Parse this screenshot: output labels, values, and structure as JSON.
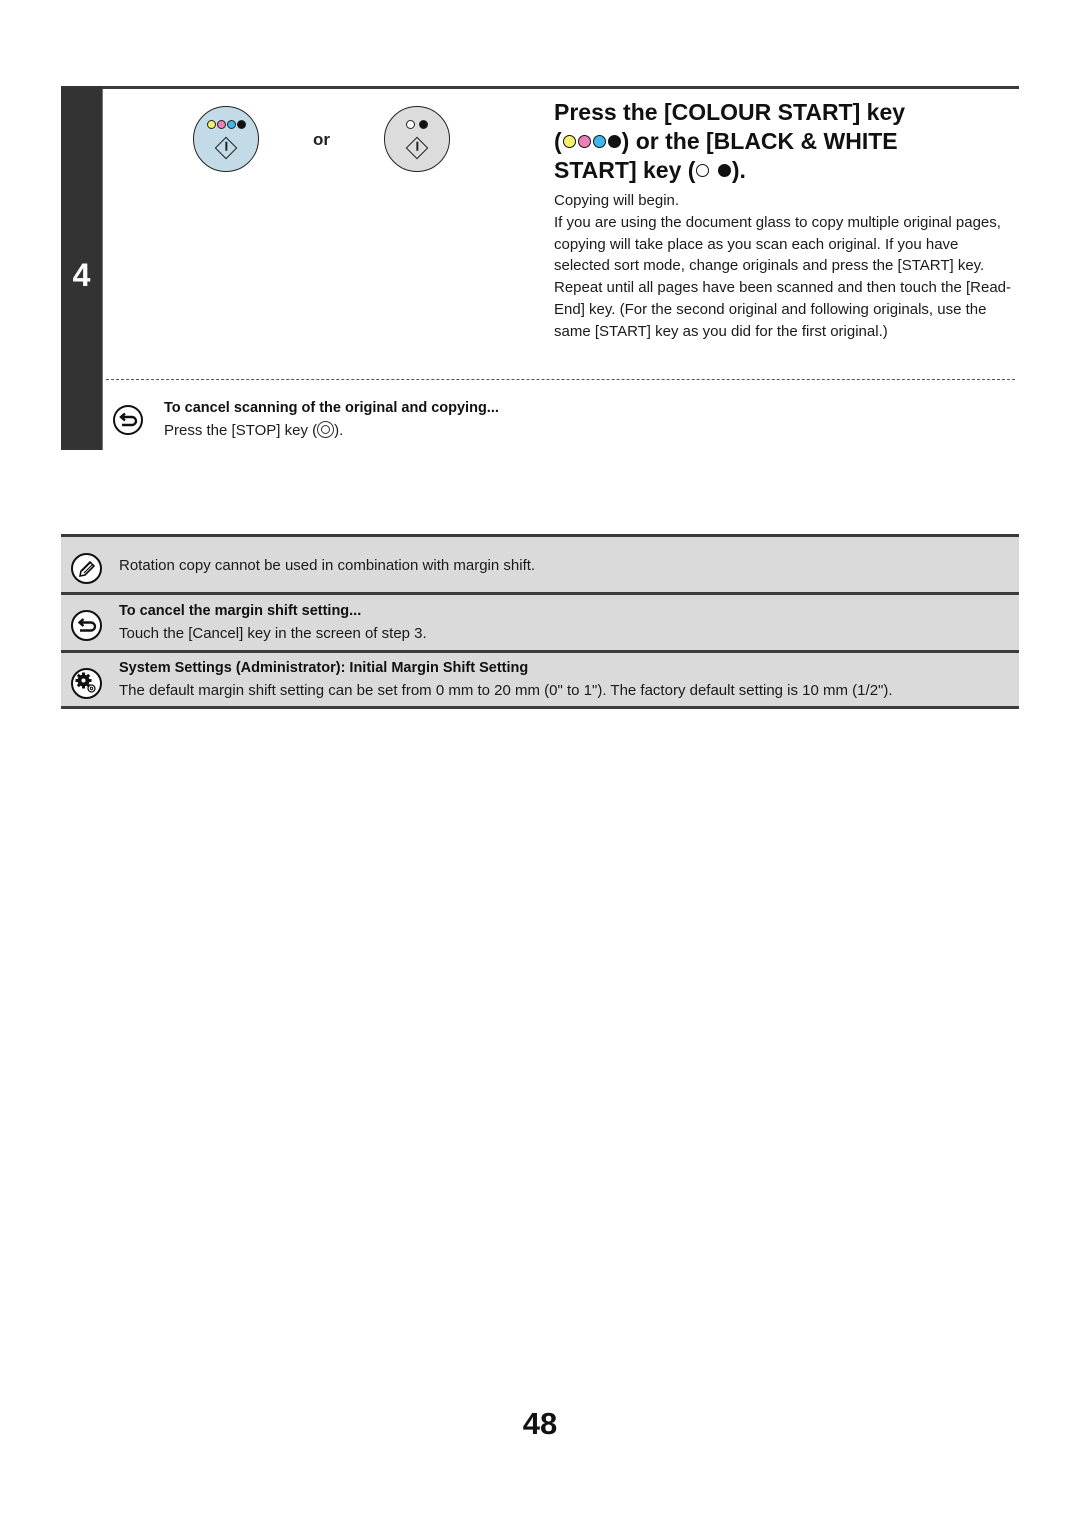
{
  "step": {
    "number": "4",
    "or_label": "or",
    "colour_key_dot_colors": [
      "#f4ee6e",
      "#ee7fb6",
      "#3db8ec",
      "#111111"
    ],
    "bw_key_dot_colors": [
      "#ffffff",
      "#111111"
    ],
    "title": {
      "line1": "Press the [COLOUR START] key",
      "line2_open": "(",
      "line2_rest": ") or the [BLACK & WHITE",
      "line3_start": "START] key (",
      "line3_end": ")."
    },
    "body": {
      "first": "Copying will begin.",
      "second": "If you are using the document glass to copy multiple original pages, copying will take place as you scan each original. If you have selected sort mode, change originals and press the [START] key. Repeat until all pages have been scanned and then touch the [Read-End] key. (For the second original and following originals, use the same [START] key as you did for the first original.)"
    },
    "cancel": {
      "title": "To cancel scanning of the original and copying...",
      "body_before": "Press the [STOP] key (",
      "body_after": ")."
    }
  },
  "notes": [
    {
      "icon": "pencil-icon",
      "text": "Rotation copy cannot be used in combination with margin shift."
    },
    {
      "icon": "cancel-return-icon",
      "title": "To cancel the margin shift setting...",
      "text": "Touch the [Cancel] key in the screen of step 3."
    },
    {
      "icon": "system-settings-gear-icon",
      "title": "System Settings (Administrator): Initial Margin Shift Setting",
      "text": "The default margin shift setting can be set from 0 mm to 20 mm (0\" to 1\"). The factory default setting is 10 mm (1/2\")."
    }
  ],
  "page_number": "48"
}
